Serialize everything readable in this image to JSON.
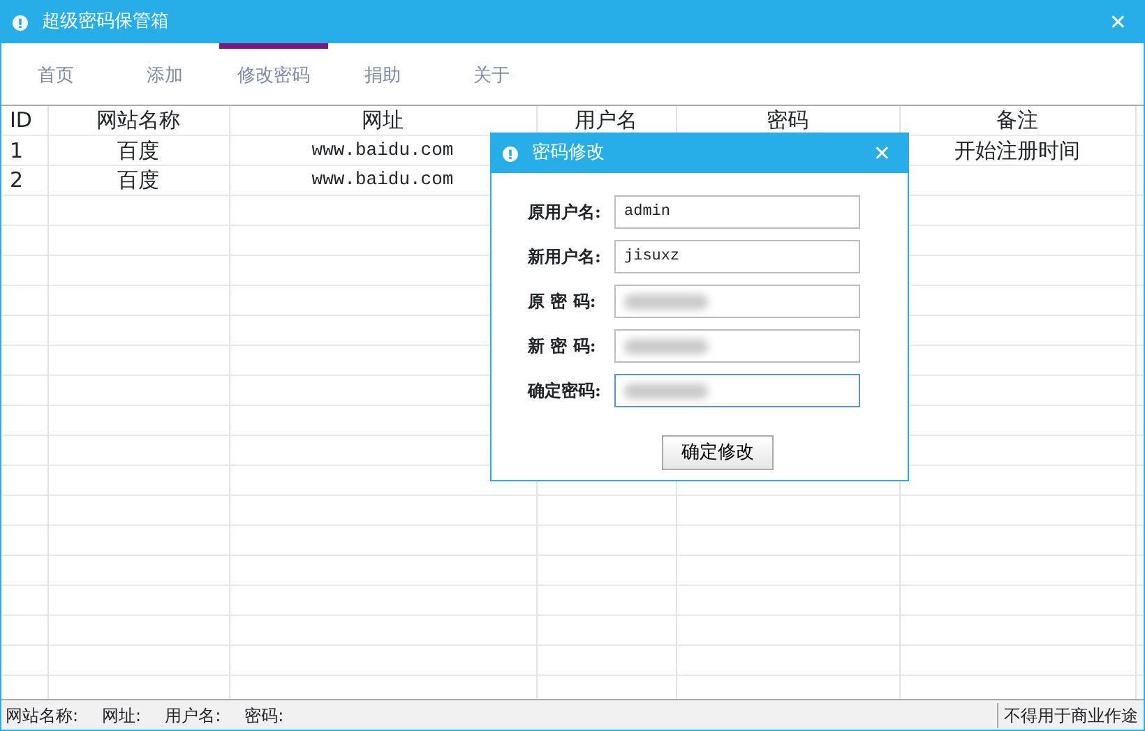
{
  "window": {
    "title": "超级密码保管箱",
    "close": "✕"
  },
  "tabs": [
    {
      "label": "首页",
      "selected": false
    },
    {
      "label": "添加",
      "selected": false
    },
    {
      "label": "修改密码",
      "selected": true
    },
    {
      "label": "捐助",
      "selected": false
    },
    {
      "label": "关于",
      "selected": false
    }
  ],
  "table": {
    "columns": [
      "ID",
      "网站名称",
      "网址",
      "用户名",
      "密码",
      "备注"
    ],
    "rows": [
      [
        "1",
        "百度",
        "www.baidu.com",
        null,
        null,
        "开始注册时间"
      ],
      [
        "2",
        "百度",
        "www.baidu.com",
        null,
        null,
        ""
      ]
    ]
  },
  "dialog": {
    "title": "密码修改",
    "close": "✕",
    "fields": [
      {
        "label": "原用户名:",
        "value": "admin",
        "masked": false,
        "focused": false
      },
      {
        "label": "新用户名:",
        "value": "jisuxz",
        "masked": false,
        "focused": false
      },
      {
        "label": "原 密 码:",
        "masked": true,
        "focused": false
      },
      {
        "label": "新 密 码:",
        "masked": true,
        "focused": false
      },
      {
        "label": "确定密码:",
        "masked": true,
        "focused": true
      }
    ],
    "button": "确定修改"
  },
  "status_bar": {
    "items": [
      "网站名称:",
      "网址:",
      "用户名:",
      "密码:"
    ],
    "note": "不得用于商业作途"
  }
}
